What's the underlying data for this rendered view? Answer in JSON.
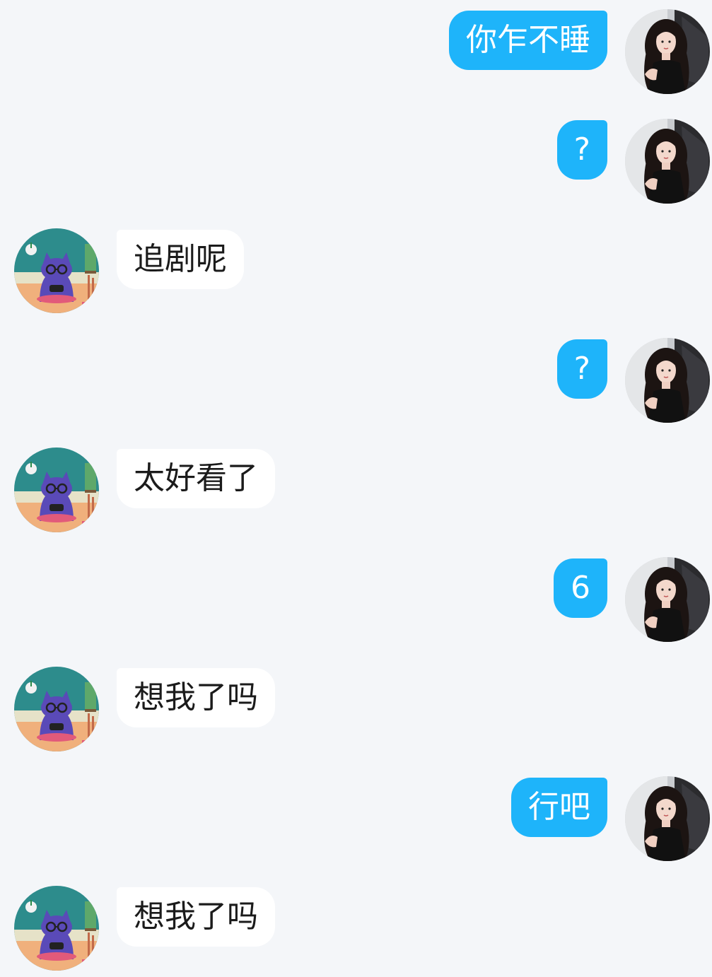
{
  "conversation": {
    "messages": [
      {
        "side": "out",
        "text": "你乍不睡",
        "avatar_icon": "woman-portrait-avatar"
      },
      {
        "side": "out",
        "text": "?",
        "avatar_icon": "woman-portrait-avatar"
      },
      {
        "side": "in",
        "text": "追剧呢",
        "avatar_icon": "cartoon-cat-avatar"
      },
      {
        "side": "out",
        "text": "?",
        "avatar_icon": "woman-portrait-avatar"
      },
      {
        "side": "in",
        "text": "太好看了",
        "avatar_icon": "cartoon-cat-avatar"
      },
      {
        "side": "out",
        "text": "6",
        "avatar_icon": "woman-portrait-avatar"
      },
      {
        "side": "in",
        "text": "想我了吗",
        "avatar_icon": "cartoon-cat-avatar"
      },
      {
        "side": "out",
        "text": "行吧",
        "avatar_icon": "woman-portrait-avatar"
      },
      {
        "side": "in",
        "text": "想我了吗",
        "avatar_icon": "cartoon-cat-avatar"
      }
    ]
  },
  "colors": {
    "background": "#f4f6f9",
    "outgoing_bubble": "#1eb4fa",
    "incoming_bubble": "#ffffff",
    "outgoing_text": "#ffffff",
    "incoming_text": "#1b1b1b"
  }
}
